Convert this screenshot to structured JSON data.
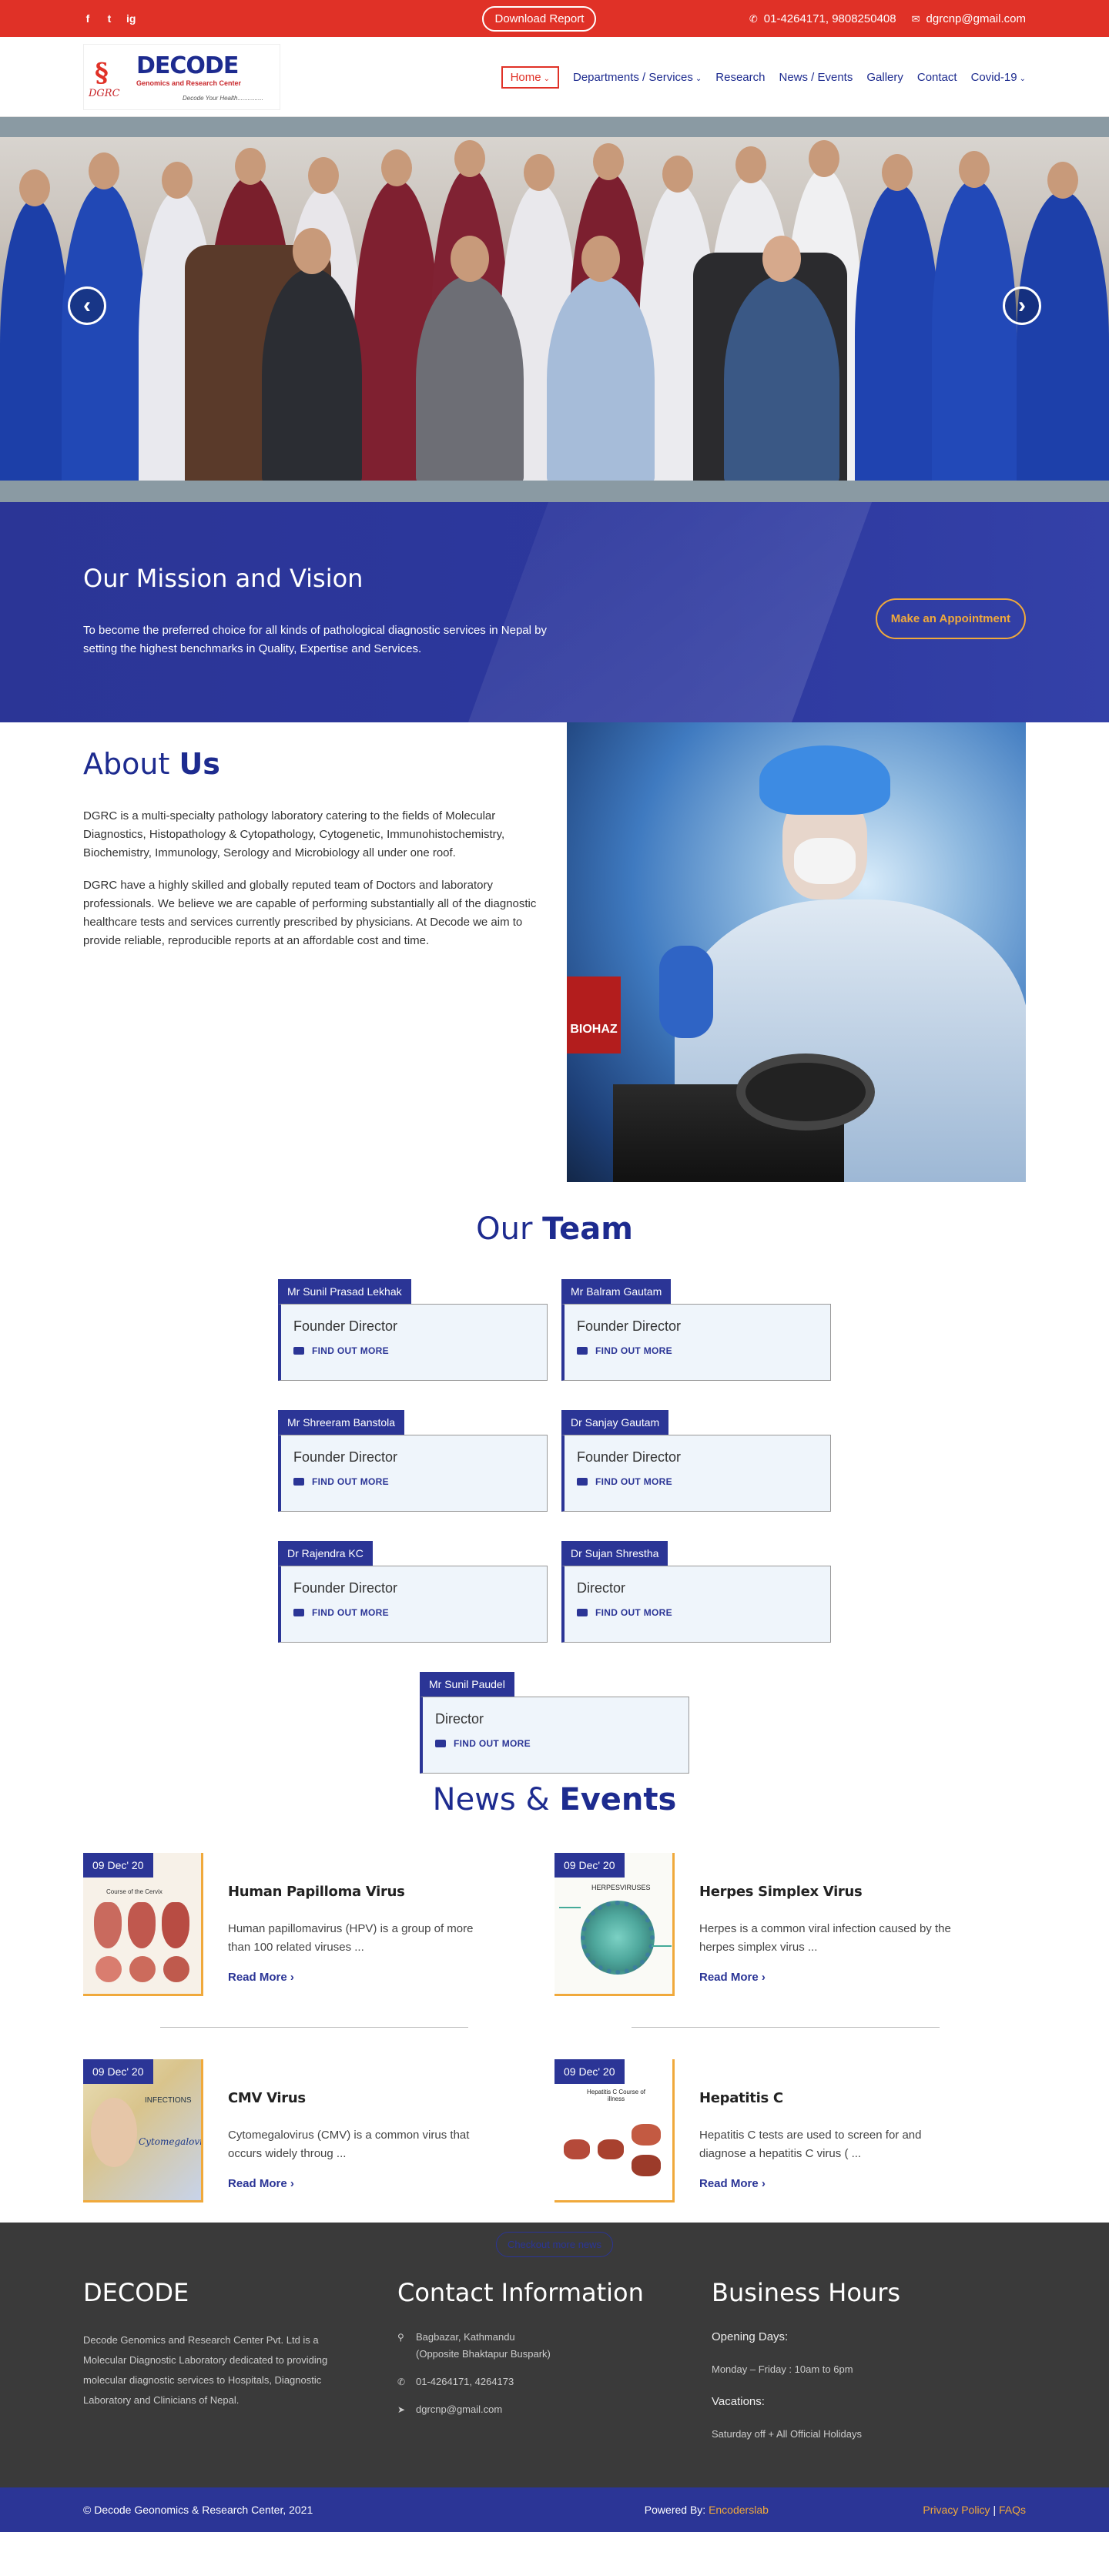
{
  "topbar": {
    "socials": [
      "f",
      "t",
      "ig"
    ],
    "download_label": "Download Report",
    "phone": "01-4264171, 9808250408",
    "email": "dgrcnp@gmail.com"
  },
  "logo": {
    "name": "DECODE",
    "subtitle": "Genomics and Research Center",
    "initials": "DGRC",
    "tagline": "Decode Your Health..............."
  },
  "nav": {
    "items": [
      {
        "label": "Home",
        "chevron": "⌄"
      },
      {
        "label": "Departments / Services",
        "chevron": "⌄"
      },
      {
        "label": "Research"
      },
      {
        "label": "News / Events"
      },
      {
        "label": "Gallery"
      },
      {
        "label": "Contact"
      },
      {
        "label": "Covid-19",
        "chevron": "⌄"
      }
    ]
  },
  "slider": {
    "prev": "‹",
    "next": "›"
  },
  "mission": {
    "title": "Our Mission and Vision",
    "text": "To become the preferred choice for all kinds of pathological diagnostic services in Nepal by setting the highest benchmarks in Quality, Expertise and Services.",
    "button": "Make an Appointment"
  },
  "about": {
    "title_a": "About",
    "title_b": "Us",
    "p1": "DGRC is a multi-specialty pathology laboratory catering to the fields of Molecular Diagnostics, Histopathology & Cytopathology, Cytogenetic, Immunohistochemistry, Biochemistry, Immunology, Serology and Microbiology all under one roof.",
    "p2": "DGRC have a highly skilled and globally reputed team of Doctors and laboratory professionals. We believe we are capable of performing substantially all of the diagnostic healthcare tests and services currently prescribed by physicians. At Decode we aim to provide reliable, reproducible reports at an affordable cost and time.",
    "image_label": "BIOHAZ"
  },
  "team": {
    "title_a": "Our",
    "title_b": "Team",
    "find_label": "FIND OUT MORE",
    "members": [
      {
        "name": "Mr Sunil Prasad Lekhak",
        "role": "Founder Director"
      },
      {
        "name": "Mr Balram Gautam",
        "role": "Founder Director"
      },
      {
        "name": "Mr Shreeram Banstola",
        "role": "Founder Director"
      },
      {
        "name": "Dr Sanjay Gautam",
        "role": "Founder Director"
      },
      {
        "name": "Dr Rajendra KC",
        "role": "Founder Director"
      },
      {
        "name": "Dr Sujan Shrestha",
        "role": "Director"
      },
      {
        "name": "Mr Sunil Paudel",
        "role": "Director"
      }
    ]
  },
  "news": {
    "title_a": "News &",
    "title_b": "Events",
    "read_more": "Read More ›",
    "items": [
      {
        "date": "09 Dec' 20",
        "title": "Human Papilloma Virus",
        "text": "Human papillomavirus (HPV) is a group of more than 100 related viruses ...",
        "thumb_text": "Course of the Cervix"
      },
      {
        "date": "09 Dec' 20",
        "title": "Herpes Simplex Virus",
        "text": "Herpes is a common viral infection caused by the herpes simplex virus ...",
        "thumb_text": "HERPESVIRUSES"
      },
      {
        "date": "09 Dec' 20",
        "title": "CMV Virus",
        "text": "Cytomegalovirus (CMV) is a common virus that occurs widely throug ...",
        "thumb_text": "INFECTIONS",
        "thumb_text2": "Cytomegalovirus"
      },
      {
        "date": "09 Dec' 20",
        "title": "Hepatitis C",
        "text": "Hepatitis C tests are used to screen for and diagnose a hepatitis C virus ( ...",
        "thumb_text": "Hepatitis C Course of illness"
      }
    ],
    "more_button": "Checkout more news"
  },
  "footer": {
    "col1_title": "DECODE",
    "col1_text": "Decode Genomics and Research Center Pvt. Ltd is a Molecular Diagnostic Laboratory dedicated to providing molecular diagnostic services to Hospitals, Diagnostic Laboratory and Clinicians of Nepal.",
    "col2_title": "Contact Information",
    "address_1": "Bagbazar, Kathmandu",
    "address_2": "(Opposite Bhaktapur Buspark)",
    "phone": "01-4264171, 4264173",
    "email": "dgrcnp@gmail.com",
    "col3_title": "Business Hours",
    "opening_label": "Opening Days:",
    "opening_value": "Monday – Friday : 10am to 6pm",
    "vacation_label": "Vacations:",
    "vacation_value": "Saturday off + All Official Holidays"
  },
  "copyright": {
    "text": "© Decode Geonomics & Research Center, 2021",
    "powered_prefix": "Powered By:",
    "powered_by": "Encoderslab",
    "privacy": "Privacy Policy",
    "separator": "|",
    "faqs": "FAQs"
  },
  "colors": {
    "topbar": "#e03127",
    "primary": "#2b3596",
    "accent": "#f0a93b",
    "footer": "#3a3a3a"
  }
}
